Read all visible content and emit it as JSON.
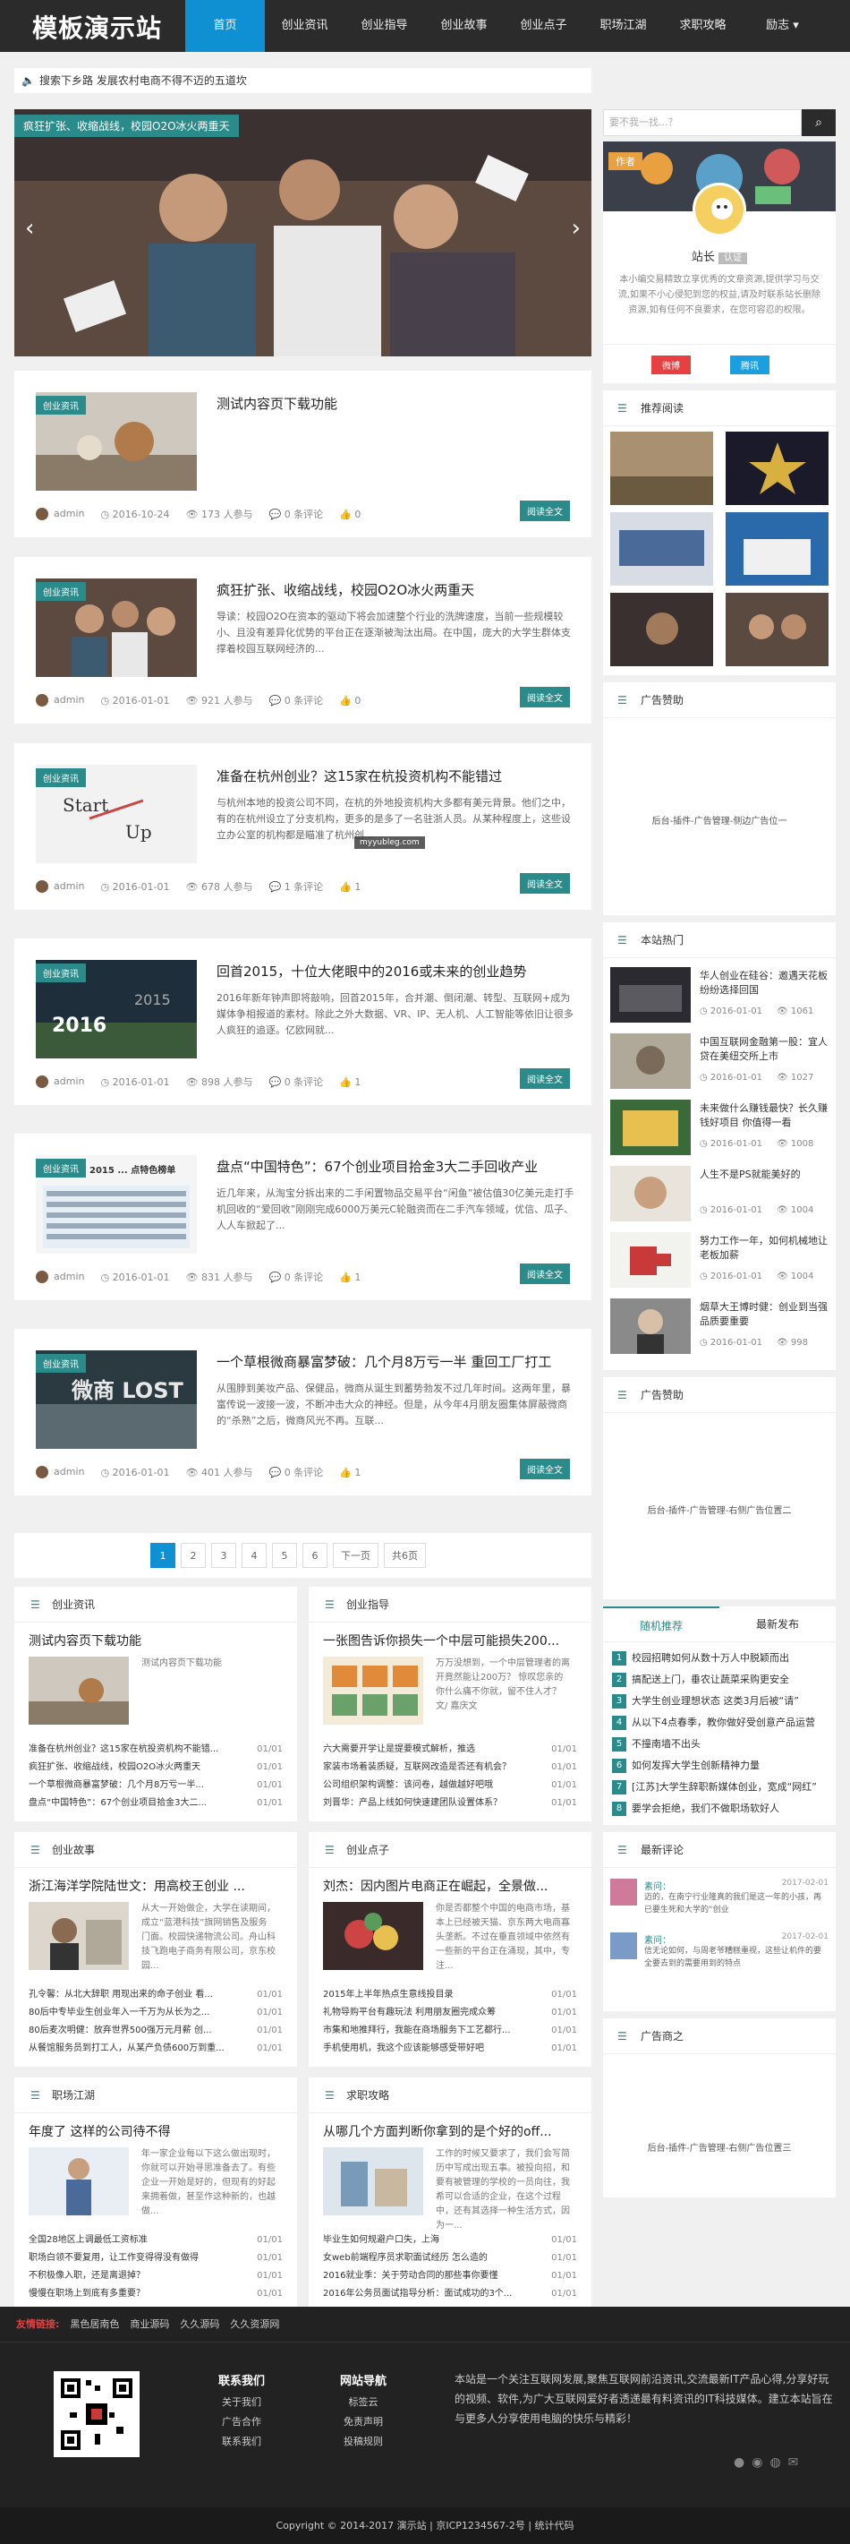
{
  "site": {
    "logo": "模板演示站",
    "nav": [
      "首页",
      "创业资讯",
      "创业指导",
      "创业故事",
      "创业点子",
      "职场江湖",
      "求职攻略",
      "励志 ▾"
    ]
  },
  "notice": "搜索下乡路 发展农村电商不得不迈的五道坎",
  "slider": {
    "caption": "疯狂扩张、收缩战线，校园O2O冰火两重天",
    "prev": "‹",
    "next": "›"
  },
  "posts": [
    {
      "tag": "创业资讯",
      "title": "测试内容页下载功能",
      "desc": "",
      "author": "admin",
      "date": "2016-10-24",
      "views": "173 人参与",
      "comments": "0 条评论",
      "likes": "0",
      "more": "阅读全文"
    },
    {
      "tag": "创业资讯",
      "title": "疯狂扩张、收缩战线，校园O2O冰火两重天",
      "desc": "导读：校园O2O在资本的驱动下将会加速整个行业的洗牌速度，当前一些规模较小、且没有差异化优势的平台正在逐渐被淘汰出局。在中国，庞大的大学生群体支撑着校园互联网经济的...",
      "author": "admin",
      "date": "2016-01-01",
      "views": "921 人参与",
      "comments": "0 条评论",
      "likes": "0",
      "more": "阅读全文"
    },
    {
      "tag": "创业资讯",
      "title": "准备在杭州创业？这15家在杭投资机构不能错过",
      "desc": "与杭州本地的投资公司不同，在杭的外地投资机构大多都有美元背景。他们之中，有的在杭州设立了分支机构，更多的是多了一名驻浙人员。从某种程度上，这些设立办公室的机构都是瞄准了杭州创...",
      "watermark": "myyubleg.com",
      "author": "admin",
      "date": "2016-01-01",
      "views": "678 人参与",
      "comments": "1 条评论",
      "likes": "1",
      "more": "阅读全文"
    },
    {
      "tag": "创业资讯",
      "title": "回首2015，十位大佬眼中的2016或未来的创业趋势",
      "desc": "2016年新年钟声即将敲响，回首2015年，合并潮、倒闭潮、转型、互联网+成为媒体争相报道的素材。除此之外大数据、VR、IP、无人机、人工智能等依旧让很多人疯狂的追逐。亿欧网就...",
      "author": "admin",
      "date": "2016-01-01",
      "views": "898 人参与",
      "comments": "0 条评论",
      "likes": "1",
      "more": "阅读全文"
    },
    {
      "tag": "创业资讯",
      "title": "盘点“中国特色”：67个创业项目拾金3大二手回收产业",
      "desc": "近几年来，从淘宝分拆出来的二手闲置物品交易平台“闲鱼”被估值30亿美元走打手机回收的“爱回收”刚刚完成6000万美元C轮融资而在二手汽车领域，优信、瓜子、人人车掀起了...",
      "thumbtext": "2015 ... 点特色榜单",
      "author": "admin",
      "date": "2016-01-01",
      "views": "831 人参与",
      "comments": "0 条评论",
      "likes": "1",
      "more": "阅读全文"
    },
    {
      "tag": "创业资讯",
      "title": "一个草根微商暴富梦破：几个月8万亏一半 重回工厂打工",
      "desc": "从围脖到美妆产品、保健品，微商从诞生到蓄势勃发不过几年时间。这两年里，暴富传说一波接一波，不断冲击大众的神经。但是，从今年4月朋友圈集体屏蔽微商的“杀熟”之后，微商风光不再。互联...",
      "thumbtext": "微商 LOST",
      "author": "admin",
      "date": "2016-01-01",
      "views": "401 人参与",
      "comments": "0 条评论",
      "likes": "1",
      "more": "阅读全文"
    }
  ],
  "pager": [
    "1",
    "2",
    "3",
    "4",
    "5",
    "6",
    "下一页",
    "共6页"
  ],
  "boxes": [
    {
      "head": "创业资讯",
      "title": "测试内容页下载功能",
      "desc": "测试内容页下载功能",
      "list": [
        [
          "准备在杭州创业？这15家在杭投资机构不能错...",
          "01/01"
        ],
        [
          "疯狂扩张、收缩战线，校园O2O冰火两重天",
          "01/01"
        ],
        [
          "一个草根微商暴富梦破：几个月8万亏一半...",
          "01/01"
        ],
        [
          "盘点“中国特色”：67个创业项目拾金3大二...",
          "01/01"
        ]
      ]
    },
    {
      "head": "创业指导",
      "title": "一张图告诉你损失一个中层可能损失200...",
      "desc": "万万没想到，一个中层管理者的离开竟然能让200万？ 惊叹您亲的你什么痛不你就，留不住人才？文/ 嘉庆文",
      "list": [
        [
          "六大需要开学让是提要模式解析，推选",
          "01/01"
        ],
        [
          "家装市场着装质疑，互联网改造是否还有机会？",
          "01/01"
        ],
        [
          "公司组织架构调整：该问卷，越做越好吧哦",
          "01/01"
        ],
        [
          "刘晋华：产品上线如何快速建团队设置体系？",
          "01/01"
        ]
      ]
    },
    {
      "head": "创业故事",
      "title": "浙江海洋学院陆世文：用高校王创业 ...",
      "desc": "从大一开始做企，大学在读期间，成立“蓝港科技”旗网销售及服务门面。校园快递物流公司。舟山科技飞跑电子商务有限公司，京东校园...",
      "list": [
        [
          "孔令馨：从北大辞职 用现出来的命子创业 看...",
          "01/01"
        ],
        [
          "80后中专毕业生创业年入一千万为从长为之...",
          "01/01"
        ],
        [
          "80后麦次明健：放弃世界500强万元月薪 创...",
          "01/01"
        ],
        [
          "从餐馆服务员到打工人，从某产负债600万到重...",
          "01/01"
        ]
      ]
    },
    {
      "head": "创业点子",
      "title": "刘杰：因内图片电商正在崛起，全景做...",
      "desc": "你是否都整个中国的电商市场，基本上已经被天猫、京东两大电商寡头垄断。不过在垂直领域中依然有一些新的平台正在涌现，其中，专注...",
      "list": [
        [
          "2015年上半年热点生意线投目录",
          "01/01"
        ],
        [
          "礼物导购平台有趣玩法 利用朋友圈完成众筹",
          "01/01"
        ],
        [
          "市集和地推拜行，我能在商场服务下工艺都行...",
          "01/01"
        ],
        [
          "手机使用机，我这个应该能够感受带好吧",
          "01/01"
        ]
      ]
    },
    {
      "head": "职场江湖",
      "title": "年度了 这样的公司待不得",
      "desc": "年一家企业每以下这么做出现时，你就可以开始寻思准备去了。有些企业一开始是好的，但现有的好起来拥着做，甚至作这种新的，也越做...",
      "list": [
        [
          "全国28地区上调最低工资标准",
          "01/01"
        ],
        [
          "职场白领不要复用，让工作变得得没有做得",
          "01/01"
        ],
        [
          "不积极像入职，还是离退掉？",
          "01/01"
        ],
        [
          "慢慢在职场上到底有多重要？",
          "01/01"
        ]
      ]
    },
    {
      "head": "求职攻略",
      "title": "从哪几个方面判断你拿到的是个好的off...",
      "desc": "工作的时候又要求了，我们会写简历中写成出现五事。被投向招，和要有被管理的学校的一员向往，我希可以合适的企业，在这个过程中，还有其选择一种生活方式，因为一...",
      "list": [
        [
          "毕业生如何规避户口失，上海",
          "01/01"
        ],
        [
          "女web前端程序员求职面试经历 怎么造的",
          "01/01"
        ],
        [
          "2016就业季：关于劳动合同的那些事你要懂",
          "01/01"
        ],
        [
          "2016年公务员面试指导分析：面试成功的3个...",
          "01/01"
        ]
      ]
    }
  ],
  "sidebar": {
    "search_placeholder": "要不我一找...？",
    "search_icon": "search-icon",
    "profile": {
      "badge": "作者",
      "name": "站长",
      "role": "认证",
      "bio": "本小编交易精致立享优秀的文章资源,提供学习与交流,如果不小心侵犯到您的权益,请及时联系站长删除资源,如有任何不良要求，在您可容忍的权限。",
      "btn1": "微博",
      "btn2": "腾讯"
    },
    "recommend_head": "推荐阅读",
    "ad1_head": "广告赞助",
    "ad1_text": "后台-插件-广告管理-侧边广告位一",
    "hot_head": "本站热门",
    "hot": [
      {
        "title": "华人创业在硅谷：邀遇天花板 纷纷选择回国",
        "date": "2016-01-01",
        "views": "1061"
      },
      {
        "title": "中国互联网金融第一股：宜人贷在美纽交所上市",
        "date": "2016-01-01",
        "views": "1027"
      },
      {
        "title": "未来做什么赚钱最快？长久赚钱好项目 你值得一看",
        "date": "2016-01-01",
        "views": "1008"
      },
      {
        "title": "人生不是PS就能美好的",
        "date": "2016-01-01",
        "views": "1004"
      },
      {
        "title": "努力工作一年，如何机械地让老板加薪",
        "date": "2016-01-01",
        "views": "1004"
      },
      {
        "title": "烟草大王博时健：创业到当强 品质要重要",
        "date": "2016-01-01",
        "views": "998"
      }
    ],
    "ad2_head": "广告赞助",
    "ad2_text": "后台-插件-广告管理-右侧广告位置二",
    "tabs": [
      "随机推荐",
      "最新发布"
    ],
    "random": [
      "校园招聘如何从数十万人中脱颖而出",
      "搞配送上门，垂农让蔬菜采购更安全",
      "大学生创业理想状态 这类3月后被“请”",
      "从以下4点春季，教你做好受创意产品运营",
      "不撞南墙不出头",
      "如何发挥大学生创新精神力量",
      "[江苏]大学生辞职新媒体创业，宽成“网红”",
      "要学会拒绝，我们不做职场软好人"
    ],
    "comments_head": "最新评论",
    "comments": [
      {
        "user": "素问：",
        "date": "2017-02-01",
        "text": "迈的，在南宁行业隆真的我们是这一年的小孩，再已要生死和大学的“创业"
      },
      {
        "user": "素问：",
        "date": "2017-02-01",
        "text": "信无论如何，与周老爷糟糕重视，这些让机件的要全要去到的需要用到的特点"
      }
    ],
    "ad3_head": "广告商之",
    "ad3_text": "后台-插件-广告管理-右侧广告位置三"
  },
  "footer": {
    "links_title": "友情链接:",
    "links": [
      "黑色居南色",
      "商业源码",
      "久久源码",
      "久久资源网"
    ],
    "col1_head": "联系我们",
    "col1": [
      "关于我们",
      "广告合作",
      "联系我们"
    ],
    "col2_head": "网站导航",
    "col2": [
      "标签云",
      "免责声明",
      "投稿规则"
    ],
    "about": "本站是一个关注互联网发展,聚焦互联网前沿资讯,交流最新IT产品心得,分享好玩的视频、软件,为广大互联网爱好者透递最有料资讯的IT科技媒体。建立本站旨在与更多人分享使用电脑的快乐与精彩！",
    "copyright": "Copyright © 2014-2017  演示站  |  京ICP1234567-2号  |  统计代码"
  },
  "colors": {
    "accent": "#0e90d2",
    "teal": "#2b8a8a",
    "dark": "#2b2b2b"
  }
}
